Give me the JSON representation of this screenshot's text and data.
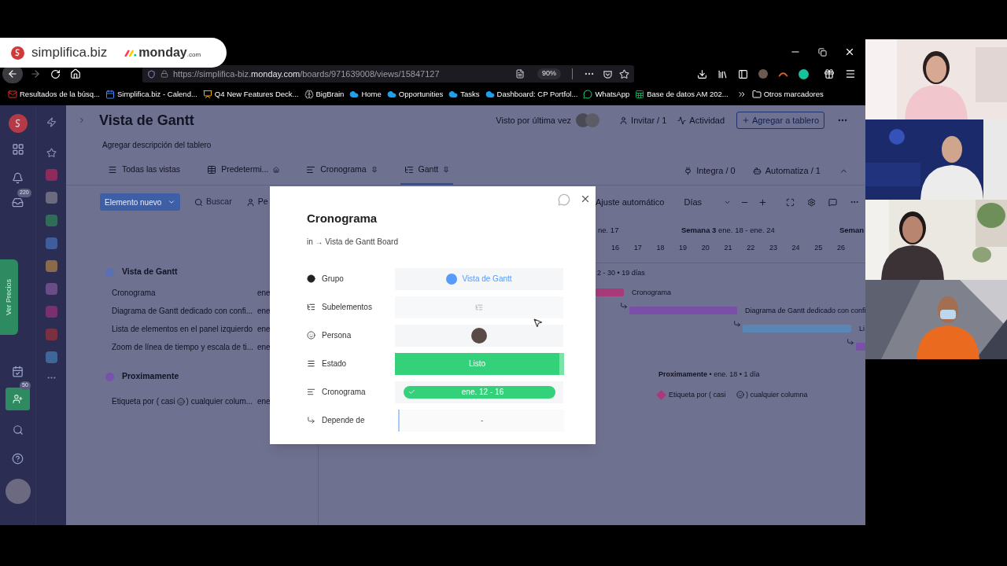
{
  "logos": {
    "brand": "simplifica.biz",
    "partner": "monday",
    "partner_suffix": ".com"
  },
  "browser": {
    "url_scheme_host": "https://simplifica-biz.",
    "url_domain": "monday.com",
    "url_path": "/boards/971639008/views/15847127",
    "zoom": "90%",
    "bookmarks": [
      {
        "label": "Resultados de la búsq...",
        "kind": "mail"
      },
      {
        "label": "Simplifica.biz - Calend...",
        "kind": "calendar"
      },
      {
        "label": "Q4 New Features Deck...",
        "kind": "slides"
      },
      {
        "label": "BigBrain",
        "kind": "brain"
      },
      {
        "label": "Home",
        "kind": "cloud"
      },
      {
        "label": "Opportunities",
        "kind": "cloud"
      },
      {
        "label": "Tasks",
        "kind": "cloud"
      },
      {
        "label": "Dashboard: CP Portfol...",
        "kind": "cloud"
      },
      {
        "label": "WhatsApp",
        "kind": "chat"
      },
      {
        "label": "Base de datos AM 202...",
        "kind": "sheet"
      }
    ],
    "other_bookmarks": "Otros marcadores"
  },
  "sidebar": {
    "inbox_badge": "220",
    "upgrade": "Ver Precios",
    "invite_badge": "50"
  },
  "board": {
    "title": "Vista de Gantt",
    "description": "Agregar descripción del tablero",
    "last_seen": "Visto por última vez",
    "invite": "Invitar / 1",
    "activity": "Actividad",
    "add": "Agregar a tablero",
    "views": [
      {
        "label": "Todas las vistas",
        "kind": "all",
        "selected": false
      },
      {
        "label": "Predetermi...",
        "kind": "table",
        "selected": false
      },
      {
        "label": "Cronograma",
        "kind": "timeline",
        "selected": false
      },
      {
        "label": "Gantt",
        "kind": "gantt",
        "selected": true
      }
    ],
    "integrate": "Integra / 0",
    "automate": "Automatiza / 1",
    "new_item": "Elemento nuevo",
    "search_placeholder": "Buscar",
    "person_filter": "Pe",
    "groups": [
      {
        "name": "Vista de Gantt",
        "color": "#5b6fb5",
        "items": [
          {
            "name": "Cronograma",
            "date": "ene"
          },
          {
            "name": "Diagrama de Gantt dedicado con confi...",
            "date": "ene"
          },
          {
            "name": "Lista de elementos en el panel izquierdo",
            "date": "ene"
          },
          {
            "name": "Zoom de línea de tiempo y escala de ti...",
            "date": "ene"
          }
        ]
      },
      {
        "name": "Proximamente",
        "color": "#7a4fae",
        "items": [
          {
            "name": "Etiqueta por ( casi",
            "name_end": ") cualquier colum...",
            "date": "ene"
          }
        ]
      }
    ]
  },
  "gantt": {
    "fit": "Ajuste automático",
    "scale": "Días",
    "week_prev": "ne. 17",
    "week": "Semana 3",
    "week_range": "ene. 18 - ene. 24",
    "week_next": "Seman",
    "days": [
      "16",
      "17",
      "18",
      "19",
      "20",
      "21",
      "22",
      "23",
      "24",
      "25",
      "26"
    ],
    "summary": "2 - 30 • 19 días",
    "bars": [
      {
        "label": "Cronograma",
        "color": "#a83a7a"
      },
      {
        "label": "Diagrama de Gantt dedicado con confi",
        "color": "#7a4fa8"
      },
      {
        "label": "Li",
        "color": "#5a86b5"
      },
      {
        "color": "#7a4fa8"
      }
    ],
    "group2": "Proximamente",
    "group2_meta": "• ene. 18 • 1 día",
    "milestone": {
      "start": "Etiqueta por ( casi",
      "end": ") cualquier columna",
      "color": "#a83a7a"
    }
  },
  "modal": {
    "title": "Cronograma",
    "breadcrumb": "in → Vista de Gantt Board",
    "fields": [
      {
        "kind": "group",
        "label": "Grupo",
        "value": "Vista de Gantt",
        "color": "#579bfc"
      },
      {
        "kind": "subitems",
        "label": "Subelementos"
      },
      {
        "kind": "person",
        "label": "Persona"
      },
      {
        "kind": "status",
        "label": "Estado",
        "value": "Listo",
        "color": "#33d27a"
      },
      {
        "kind": "timeline",
        "label": "Cronograma",
        "value": "ene. 12 - 16"
      },
      {
        "kind": "dependency",
        "label": "Depende de",
        "value": "-"
      }
    ]
  }
}
